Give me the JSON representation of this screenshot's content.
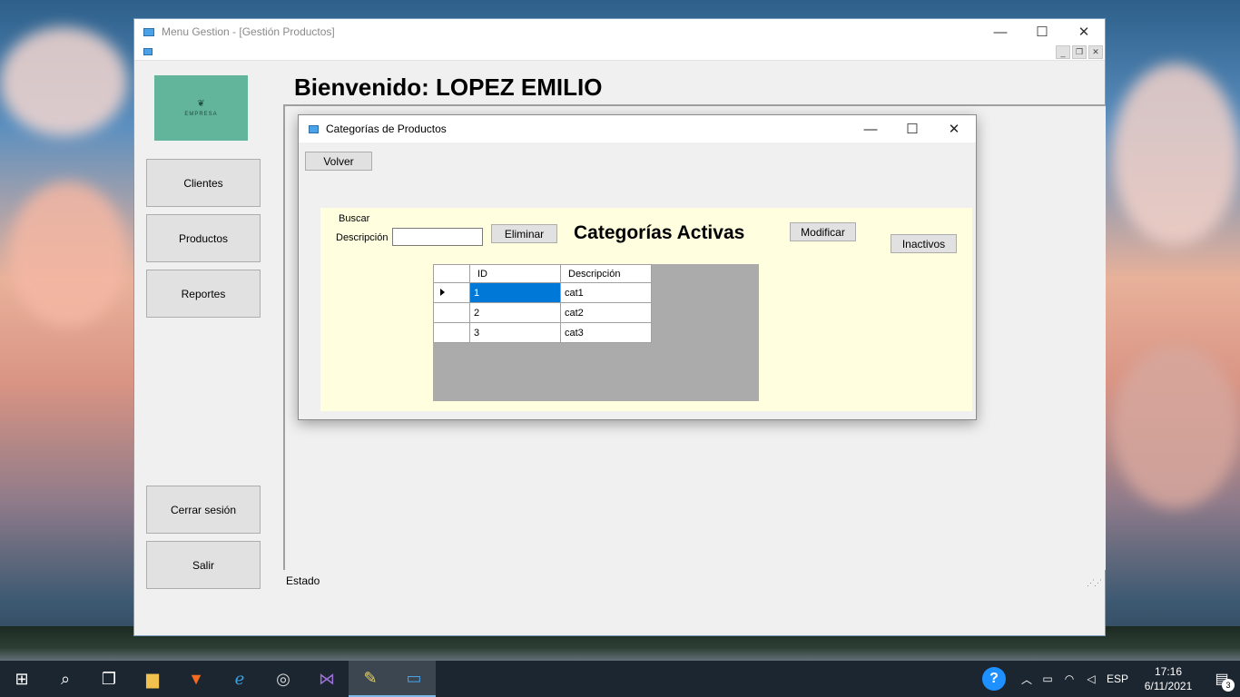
{
  "main_window": {
    "title": "Menu Gestion - [Gestión Productos]",
    "controls": {
      "minimize": "—",
      "maximize": "☐",
      "close": "✕"
    },
    "mdi_controls": {
      "minimize": "_",
      "restore": "❐",
      "close": "✕"
    }
  },
  "logo": {
    "text": "EMPRESA"
  },
  "sidebar": {
    "clientes": "Clientes",
    "productos": "Productos",
    "reportes": "Reportes",
    "cerrar_sesion": "Cerrar sesión",
    "salir": "Salir"
  },
  "welcome": "Bienvenido: LOPEZ EMILIO",
  "status": "Estado",
  "child_window": {
    "title": "Categorías de Productos",
    "controls": {
      "minimize": "—",
      "maximize": "☐",
      "close": "✕"
    },
    "volver": "Volver",
    "buscar_label": "Buscar",
    "descripcion_label": "Descripción",
    "search_value": "",
    "eliminar": "Eliminar",
    "heading": "Categorías Activas",
    "modificar": "Modificar",
    "inactivos": "Inactivos",
    "grid": {
      "columns": [
        "ID",
        "Descripción"
      ],
      "rows": [
        {
          "id": "1",
          "descripcion": "cat1"
        },
        {
          "id": "2",
          "descripcion": "cat2"
        },
        {
          "id": "3",
          "descripcion": "cat3"
        }
      ]
    }
  },
  "taskbar": {
    "items": [
      "windows-start-icon",
      "search-icon",
      "task-view-icon",
      "file-explorer-icon",
      "brave-browser-icon",
      "edge-icon",
      "safari-icon",
      "visual-studio-icon",
      "paint-icon",
      "app-window-icon"
    ],
    "tray": {
      "language": "ESP",
      "time": "17:16",
      "date": "6/11/2021",
      "notifications": "3"
    }
  }
}
